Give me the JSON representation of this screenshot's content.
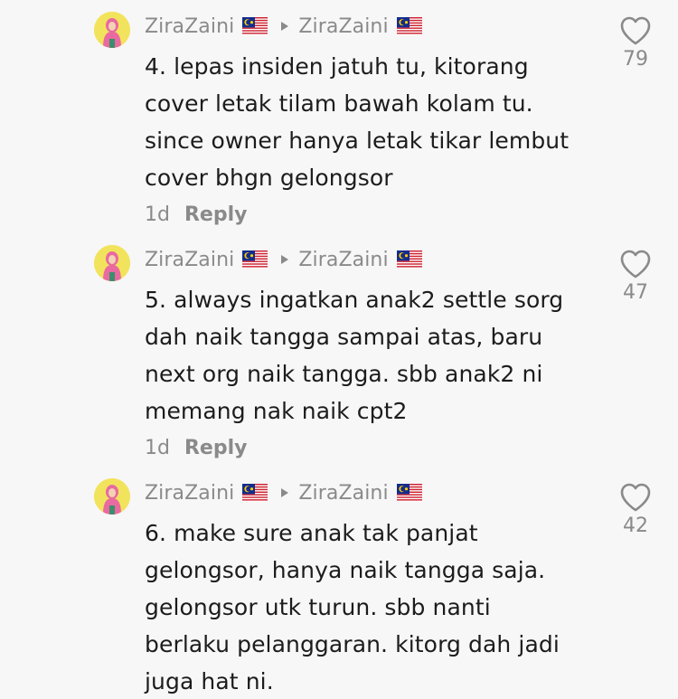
{
  "comments": [
    {
      "user": "ZiraZaini",
      "reply_to": "ZiraZaini",
      "flag_icon": "malaysia-flag-icon",
      "text": "4. lepas insiden jatuh tu, kitorang\ncover letak tilam bawah kolam tu.\nsince owner hanya letak tikar lembut\ncover bhgn gelongsor",
      "age": "1d",
      "reply_label": "Reply",
      "likes": "79"
    },
    {
      "user": "ZiraZaini",
      "reply_to": "ZiraZaini",
      "flag_icon": "malaysia-flag-icon",
      "text": "5. always ingatkan anak2 settle sorg\ndah naik tangga sampai atas, baru\nnext org naik tangga. sbb anak2 ni\nmemang nak naik cpt2",
      "age": "1d",
      "reply_label": "Reply",
      "likes": "47"
    },
    {
      "user": "ZiraZaini",
      "reply_to": "ZiraZaini",
      "flag_icon": "malaysia-flag-icon",
      "text": "6. make sure anak tak panjat\ngelongsor, hanya naik tangga saja.\ngelongsor utk turun. sbb nanti\nberlaku pelanggaran. kitorg dah jadi\njuga hat ni.",
      "likes": "42"
    }
  ],
  "colors": {
    "background": "#f7f7f7",
    "text_primary": "#1c1c1c",
    "text_secondary": "#8a8a8a",
    "avatar_bg": "#f2e35c"
  }
}
